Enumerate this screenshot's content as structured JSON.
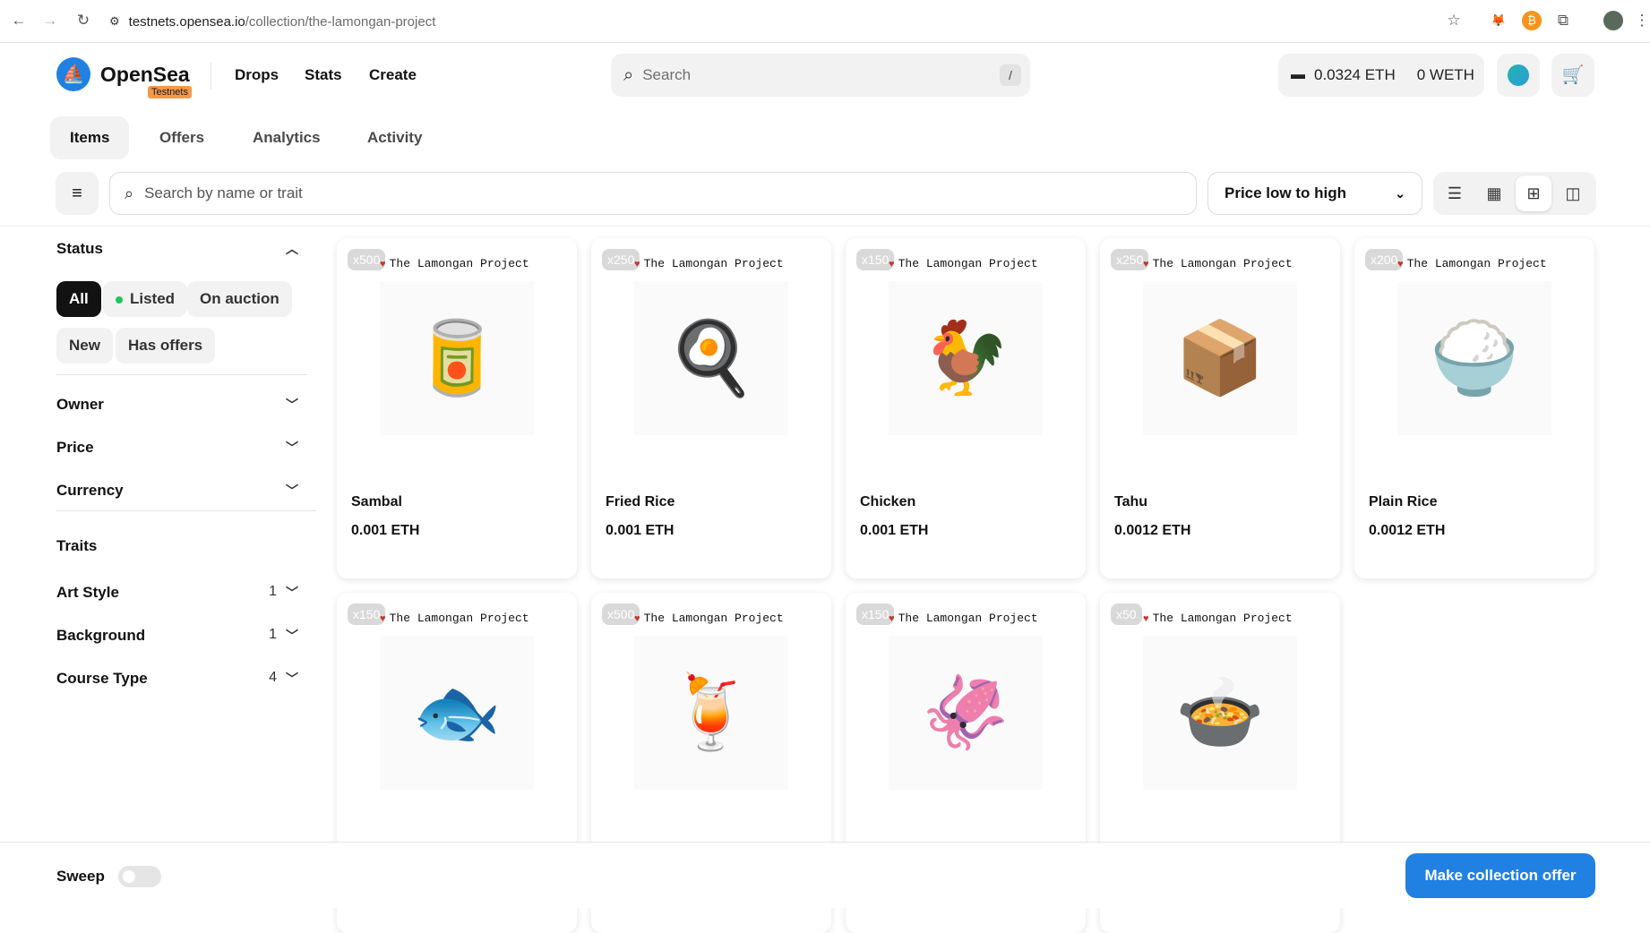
{
  "browser": {
    "url_host": "testnets.opensea.io",
    "url_path": "/collection/the-lamongan-project"
  },
  "header": {
    "brand": "OpenSea",
    "badge": "Testnets",
    "nav": [
      "Drops",
      "Stats",
      "Create"
    ],
    "search_placeholder": "Search",
    "search_shortcut": "/",
    "eth_balance": "0.0324 ETH",
    "weth_balance": "0 WETH"
  },
  "tabs": [
    "Items",
    "Offers",
    "Analytics",
    "Activity"
  ],
  "toolbar": {
    "search_placeholder": "Search by name or trait",
    "sort_label": "Price low to high"
  },
  "sidebar": {
    "status_title": "Status",
    "status_pills": [
      "All",
      "Listed",
      "On auction",
      "New",
      "Has offers"
    ],
    "filters": [
      "Owner",
      "Price",
      "Currency"
    ],
    "traits_title": "Traits",
    "traits": [
      {
        "name": "Art Style",
        "count": "1"
      },
      {
        "name": "Background",
        "count": "1"
      },
      {
        "name": "Course Type",
        "count": "4"
      }
    ]
  },
  "items": [
    {
      "qty": "x500",
      "collection": "The Lamongan Project",
      "name": "Sambal",
      "price": "0.001 ETH",
      "icon": "🥫"
    },
    {
      "qty": "x250",
      "collection": "The Lamongan Project",
      "name": "Fried Rice",
      "price": "0.001 ETH",
      "icon": "🍳"
    },
    {
      "qty": "x150",
      "collection": "The Lamongan Project",
      "name": "Chicken",
      "price": "0.001 ETH",
      "icon": "🐓"
    },
    {
      "qty": "x250",
      "collection": "The Lamongan Project",
      "name": "Tahu",
      "price": "0.0012 ETH",
      "icon": "📦"
    },
    {
      "qty": "x200",
      "collection": "The Lamongan Project",
      "name": "Plain Rice",
      "price": "0.0012 ETH",
      "icon": "🍚"
    },
    {
      "qty": "x150",
      "collection": "The Lamongan Project",
      "name": "",
      "price": "",
      "icon": "🐟"
    },
    {
      "qty": "x500",
      "collection": "The Lamongan Project",
      "name": "",
      "price": "",
      "icon": "🍹"
    },
    {
      "qty": "x150",
      "collection": "The Lamongan Project",
      "name": "",
      "price": "",
      "icon": "🦑"
    },
    {
      "qty": "x50",
      "collection": "The Lamongan Project",
      "name": "",
      "price": "",
      "icon": "🍲"
    }
  ],
  "footer": {
    "sweep_label": "Sweep",
    "offer_button": "Make collection offer"
  }
}
